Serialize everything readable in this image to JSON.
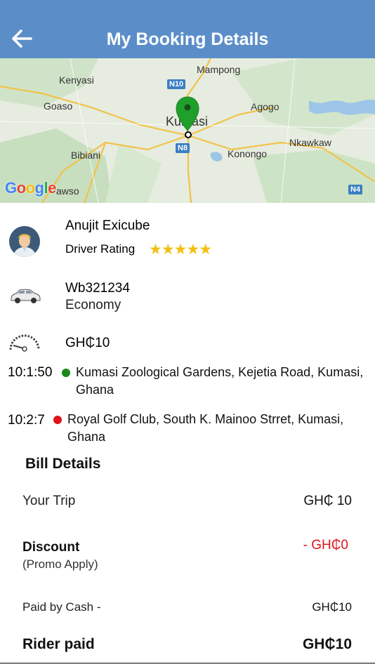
{
  "header": {
    "title": "My Booking Details",
    "back_icon": "arrow-left-icon",
    "background": "#5b8ec9"
  },
  "map": {
    "labels": [
      "Mampong",
      "Kenyasi",
      "Goaso",
      "Agogo",
      "Kumasi",
      "Bibiani",
      "Konongo",
      "Nkawkaw",
      "awso"
    ],
    "shields": [
      "N10",
      "N8",
      "N4"
    ],
    "attribution": "Google"
  },
  "driver": {
    "name": "Anujit Exicube",
    "rating_label": "Driver Rating",
    "rating": 5,
    "stars": "★★★★★"
  },
  "vehicle": {
    "plate": "Wb321234",
    "class": "Economy"
  },
  "fare": "GH₵10",
  "route": {
    "pickup": {
      "time": "10:1:50",
      "address": "Kumasi Zoological Gardens, Kejetia Road, Kumasi, Ghana",
      "color": "#1a8a1a"
    },
    "dropoff": {
      "time": "10:2:7",
      "address": "Royal Golf Club, South K. Mainoo Strret, Kumasi, Ghana",
      "color": "#e0141b"
    }
  },
  "bill": {
    "title": "Bill Details",
    "your_trip_label": "Your Trip",
    "your_trip_value": "GH₵ 10",
    "discount_label": "Discount",
    "discount_sub": "(Promo Apply)",
    "discount_value": "- GH₵0",
    "discount_color": "#e0141b",
    "paid_by_label": "Paid by Cash -",
    "paid_by_value": "GH₵10",
    "rider_paid_label": "Rider paid",
    "rider_paid_value": "GH₵10"
  }
}
